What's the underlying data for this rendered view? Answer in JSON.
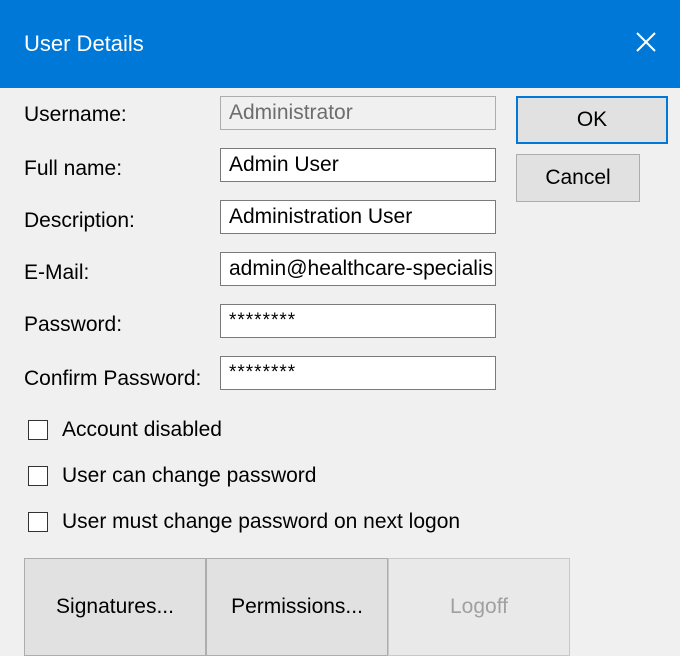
{
  "window": {
    "title": "User Details",
    "close_glyph": "✕"
  },
  "form": {
    "username": {
      "label": "Username:",
      "value": "Administrator"
    },
    "full_name": {
      "label": "Full name:",
      "value": "Admin User"
    },
    "description": {
      "label": "Description:",
      "value": "Administration User"
    },
    "email": {
      "label": "E-Mail:",
      "value": "admin@healthcare-specialis"
    },
    "password": {
      "label": "Password:",
      "value": "********"
    },
    "confirm_password": {
      "label": "Confirm Password:",
      "value": "********"
    }
  },
  "buttons": {
    "ok": "OK",
    "cancel": "Cancel",
    "signatures": "Signatures...",
    "permissions": "Permissions...",
    "logoff": "Logoff"
  },
  "checkboxes": [
    {
      "label": "Account disabled",
      "checked": false
    },
    {
      "label": "User can change password",
      "checked": false
    },
    {
      "label": "User must change password on next logon",
      "checked": false
    }
  ],
  "colors": {
    "titlebar": "#0078d7",
    "dialog_bg": "#f0f0f0",
    "button_bg": "#e1e1e1"
  },
  "icons": {
    "close": "close-icon"
  }
}
